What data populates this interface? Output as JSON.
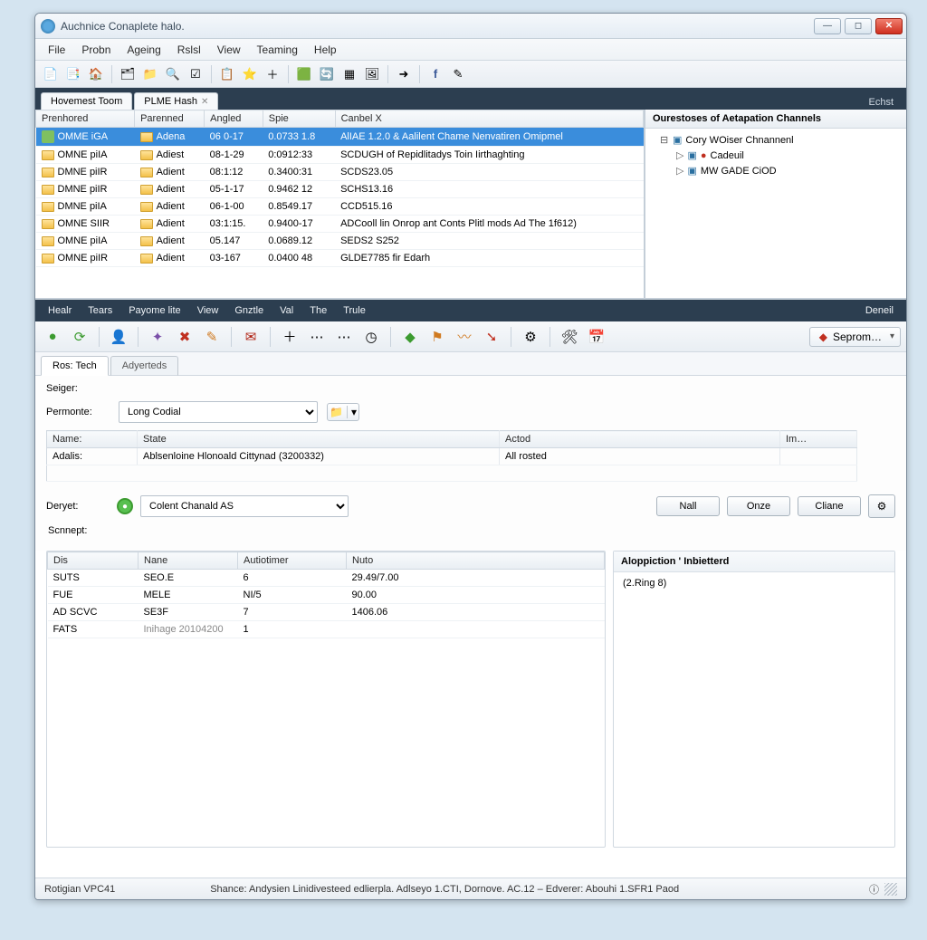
{
  "title": "Auchnice Conaplete halo.",
  "menu1": [
    "File",
    "Probn",
    "Ageing",
    "Rslsl",
    "View",
    "Teaming",
    "Help"
  ],
  "tabs_top": {
    "hovemest": "Hovemest Toom",
    "plme": "PLME Hash"
  },
  "tabstrip_right": "Echst",
  "cols": [
    "Prenhored",
    "Parenned",
    "Angled",
    "Spie",
    "Canbel X"
  ],
  "rows": [
    {
      "a": "OMME iGA",
      "b": "Adena",
      "c": "06 0-17",
      "d": "0.0733 1.8",
      "e": "AlIAE 1.2.0 & Aalilent Chame Nenvatiren Omipmel"
    },
    {
      "a": "OMNE piIA",
      "b": "Adiest",
      "c": "08-1-29",
      "d": "0:0912:33",
      "e": "SCDUGH of Repidlitadys Toin Iirthaghting"
    },
    {
      "a": "DMNE piIR",
      "b": "Adient",
      "c": "08:1:12",
      "d": "0.3400:31",
      "e": "SCDS23.05"
    },
    {
      "a": "DMNE piIR",
      "b": "Adient",
      "c": "05-1-17",
      "d": "0.9462 12",
      "e": "SCHS13.16"
    },
    {
      "a": "DMNE piIA",
      "b": "Adient",
      "c": "06-1-00",
      "d": "0.8549.17",
      "e": "CCD515.16"
    },
    {
      "a": "OMNE SIIR",
      "b": "Adient",
      "c": "03:1:15.",
      "d": "0.9400-17",
      "e": "ADCooll lin Onrop ant Conts Plitl mods Ad The 1f612)"
    },
    {
      "a": "OMNE piIA",
      "b": "Adient",
      "c": "05.147",
      "d": "0.0689.12",
      "e": "SEDS2 S252"
    },
    {
      "a": "OMNE piIR",
      "b": "Adient",
      "c": "03-167",
      "d": "0.0400 48",
      "e": "GLDE7785 fir Edarh"
    }
  ],
  "tree_head": "Ourestoses of Aetapation Channels",
  "tree_root": "Cory WOiser Chnannenl",
  "tree_children": [
    "Cadeuil",
    "MW GADE CiOD"
  ],
  "menu2": [
    "Healr",
    "Tears",
    "Payome lite",
    "View",
    "Gnztle",
    "Val",
    "The",
    "Trule"
  ],
  "menu2_right": "Deneil",
  "seprom": "Seprom…",
  "tabs2": {
    "ros": "Ros: Tech",
    "adv": "Adyerteds"
  },
  "form": {
    "seiger": "Seiger:",
    "permonte": "Permonte:",
    "permonte_value": "Long Codial",
    "deryet": "Deryet:",
    "deryet_value": "Colent Chanald AS",
    "scnnept": "Scnnept:"
  },
  "mini_cols": [
    "Name:",
    "State",
    "Actod",
    "Im…"
  ],
  "mini_rows": [
    {
      "a": "Adalis:",
      "b": "Ablsenloine Hlonoald Cittynad (3200332)",
      "c": "All rosted",
      "d": ""
    }
  ],
  "buttons": {
    "nall": "Nall",
    "onze": "Onze",
    "cliane": "Cliane"
  },
  "lcols": [
    "Dis",
    "Nane",
    "Autiotimer",
    "Nuto"
  ],
  "lrows": [
    {
      "a": "SUTS",
      "b": "SEO.E",
      "c": "6",
      "d": "29.49/7.00"
    },
    {
      "a": "FUE",
      "b": "MELE",
      "c": "NI/5",
      "d": "90.00"
    },
    {
      "a": "AD SCVC",
      "b": "SE3F",
      "c": "7",
      "d": "1406.06"
    },
    {
      "a": "FATS",
      "b": "Inihage 20104200",
      "c": "1",
      "d": ""
    }
  ],
  "rpanel_head": "Aloppiction ' Inbietterd",
  "rpanel_body": "(2.Ring 8)",
  "status_left": "Rotigian VPC41",
  "status_mid": "Shance: Andysien Linidivesteed edlierpla. Adlseyo 1.CTI, Dornove. AC.12 – Edverer: Abouhi 1.SFR1 Paod"
}
